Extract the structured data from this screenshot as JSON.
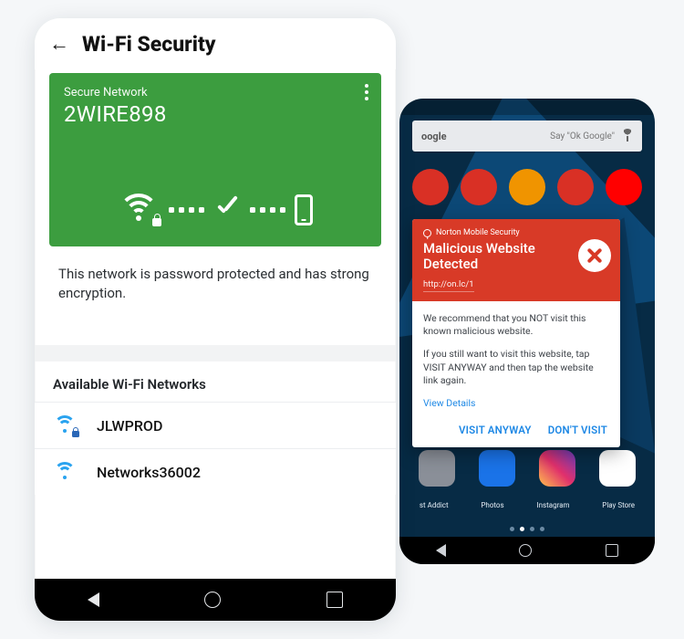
{
  "phoneA": {
    "header": {
      "title": "Wi-Fi Security"
    },
    "card": {
      "subtitle": "Secure Network",
      "ssid": "2WIRE898"
    },
    "description": "This network is password protected and has strong encryption.",
    "available_header": "Available Wi-Fi Networks",
    "networks": [
      {
        "name": "JLWPROD",
        "secured": true
      },
      {
        "name": "Networks36002",
        "secured": false
      }
    ]
  },
  "phoneB": {
    "search": {
      "brand": "oogle",
      "hint": "Say \"Ok Google\""
    },
    "dock_labels": [
      "st Addict",
      "Photos",
      "Instagram",
      "Play Store"
    ],
    "alert": {
      "app": "Norton Mobile Security",
      "title": "Malicious Website Detected",
      "url": "http://on.lc/1",
      "body1": "We recommend that you NOT visit this known malicious website.",
      "body2": "If you still want to visit this website, tap VISIT ANYWAY and then tap the website link again.",
      "view_details": "View Details",
      "action_visit": "VISIT ANYWAY",
      "action_dont": "DON'T VISIT"
    }
  }
}
